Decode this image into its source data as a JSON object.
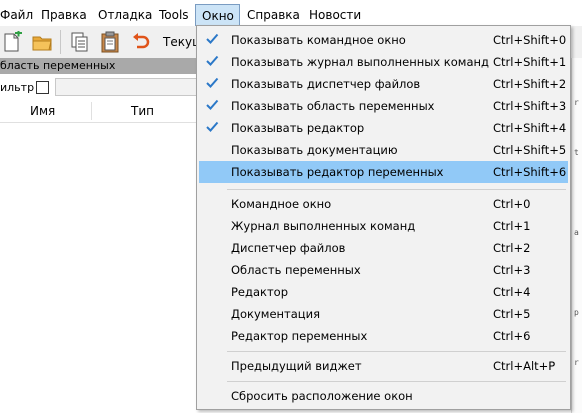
{
  "menubar": {
    "items": [
      {
        "label": "Файл"
      },
      {
        "label": "Правка"
      },
      {
        "label": "Отладка"
      },
      {
        "label": "Tools"
      },
      {
        "label": "Окно"
      },
      {
        "label": "Справка"
      },
      {
        "label": "Новости"
      }
    ],
    "active": "Окно"
  },
  "toolbar": {
    "buttons": [
      "new-file-icon",
      "open-folder-icon",
      "copy-icon",
      "paste-icon",
      "undo-icon"
    ],
    "current_label": "Текущ"
  },
  "variables_panel": {
    "title": "бласть переменных",
    "filter_label": "ильтр",
    "columns": [
      "Имя",
      "Тип"
    ]
  },
  "window_menu": {
    "items": [
      {
        "label": "Показывать командное окно",
        "shortcut": "Ctrl+Shift+0",
        "checked": true
      },
      {
        "label": "Показывать журнал выполненных команд",
        "shortcut": "Ctrl+Shift+1",
        "checked": true
      },
      {
        "label": "Показывать диспетчер файлов",
        "shortcut": "Ctrl+Shift+2",
        "checked": true
      },
      {
        "label": "Показывать область переменных",
        "shortcut": "Ctrl+Shift+3",
        "checked": true
      },
      {
        "label": "Показывать редактор",
        "shortcut": "Ctrl+Shift+4",
        "checked": true
      },
      {
        "label": "Показывать документацию",
        "shortcut": "Ctrl+Shift+5",
        "checked": false
      },
      {
        "label": "Показывать редактор переменных",
        "shortcut": "Ctrl+Shift+6",
        "checked": false,
        "highlighted": true
      },
      {
        "label": "Командное окно",
        "shortcut": "Ctrl+0"
      },
      {
        "label": "Журнал выполненных команд",
        "shortcut": "Ctrl+1"
      },
      {
        "label": "Диспетчер файлов",
        "shortcut": "Ctrl+2"
      },
      {
        "label": "Область переменных",
        "shortcut": "Ctrl+3"
      },
      {
        "label": "Редактор",
        "shortcut": "Ctrl+4"
      },
      {
        "label": "Документация",
        "shortcut": "Ctrl+5"
      },
      {
        "label": "Редактор переменных",
        "shortcut": "Ctrl+6"
      },
      {
        "label": "Предыдущий виджет",
        "shortcut": "Ctrl+Alt+P"
      },
      {
        "label": "Сбросить расположение окон",
        "shortcut": ""
      }
    ]
  },
  "colors": {
    "highlight": "#91c9f7",
    "check": "#2b78c8",
    "menu_active_bg": "#cce4f7",
    "panel_title_bg": "#a9a9a9"
  }
}
